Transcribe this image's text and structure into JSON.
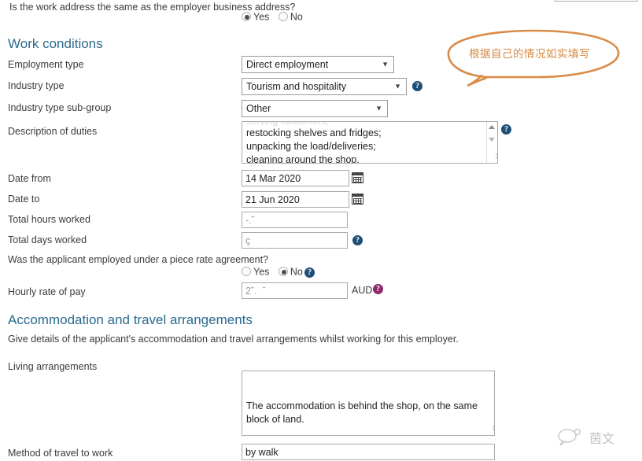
{
  "top_question": {
    "text": "Is the work address the same as the employer business address?",
    "options": [
      "Yes",
      "No"
    ],
    "selected": "Yes"
  },
  "sections": {
    "work_conditions": {
      "heading": "Work conditions"
    },
    "accommodation": {
      "heading": "Accommodation and travel arrangements",
      "intro": "Give details of the applicant's accommodation and travel arrangements whilst working for this employer."
    }
  },
  "fields": {
    "employment_type": {
      "label": "Employment type",
      "value": "Direct employment",
      "caret": "▼"
    },
    "industry_type": {
      "label": "Industry type",
      "value": "Tourism and hospitality",
      "caret": "▼"
    },
    "industry_sub_group": {
      "label": "Industry type sub-group",
      "value": "Other",
      "caret": "▼"
    },
    "description_of_duties": {
      "label": "Description of duties",
      "value": "restocking shelves and fridges;\nunpacking the load/deliveries;\ncleaning around the shop.",
      "scrolled_off_line": "serving customers;"
    },
    "date_from": {
      "label": "Date from",
      "value": "14 Mar 2020"
    },
    "date_to": {
      "label": "Date to",
      "value": "21 Jun 2020"
    },
    "total_hours_worked": {
      "label": "Total hours worked",
      "value": "-.˘"
    },
    "total_days_worked": {
      "label": "Total days worked",
      "value": "ç"
    },
    "piece_rate_question": {
      "label": "Was the applicant employed under a piece rate agreement?",
      "options": [
        "Yes",
        "No"
      ],
      "selected": "No"
    },
    "hourly_rate": {
      "label": "Hourly rate of pay",
      "value": "2˘.  ˉ",
      "currency": "AUD"
    },
    "living_arrangements": {
      "label": "Living arrangements",
      "value": "The accommodation is behind the shop, on the same\nblock of land."
    },
    "method_of_travel": {
      "label": "Method of travel to work",
      "value": "by walk"
    }
  },
  "icons": {
    "help_glyph": "?",
    "calendar_name": "calendar-icon"
  },
  "annotation": {
    "bubble_text": "根据自己的情况如实填写",
    "bubble_color": "#d98b47"
  },
  "watermark": {
    "text": "茵文"
  },
  "colors": {
    "heading": "#2b6a8f",
    "help_blue": "#1e4f78",
    "help_purple": "#8b2a68",
    "annotation_orange": "#d98b47"
  }
}
